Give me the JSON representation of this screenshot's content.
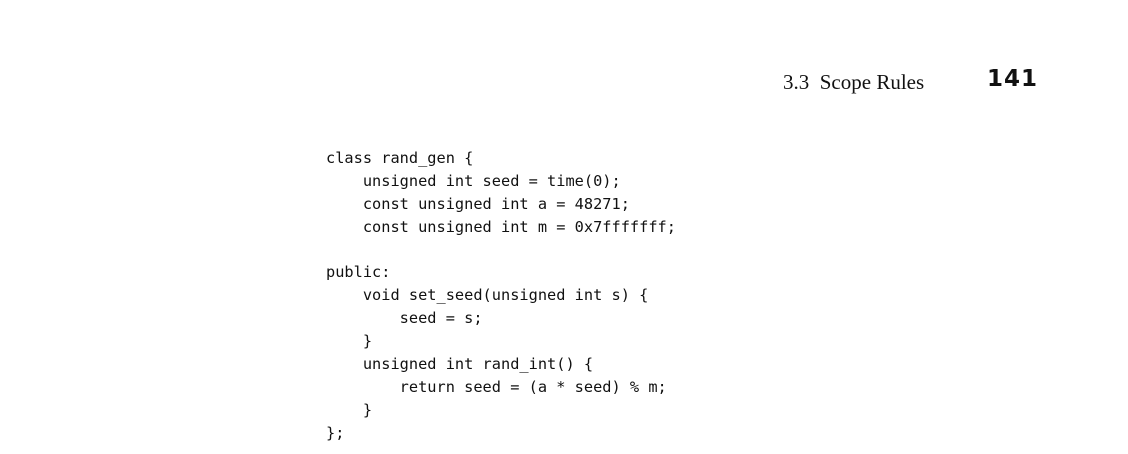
{
  "header": {
    "section_title": "3.3  Scope Rules",
    "page_number": "141"
  },
  "code": {
    "lines": [
      "class rand_gen {",
      "    unsigned int seed = time(0);",
      "    const unsigned int a = 48271;",
      "    const unsigned int m = 0x7fffffff;",
      "",
      "public:",
      "    void set_seed(unsigned int s) {",
      "        seed = s;",
      "    }",
      "    unsigned int rand_int() {",
      "        return seed = (a * seed) % m;",
      "    }",
      "};"
    ]
  }
}
